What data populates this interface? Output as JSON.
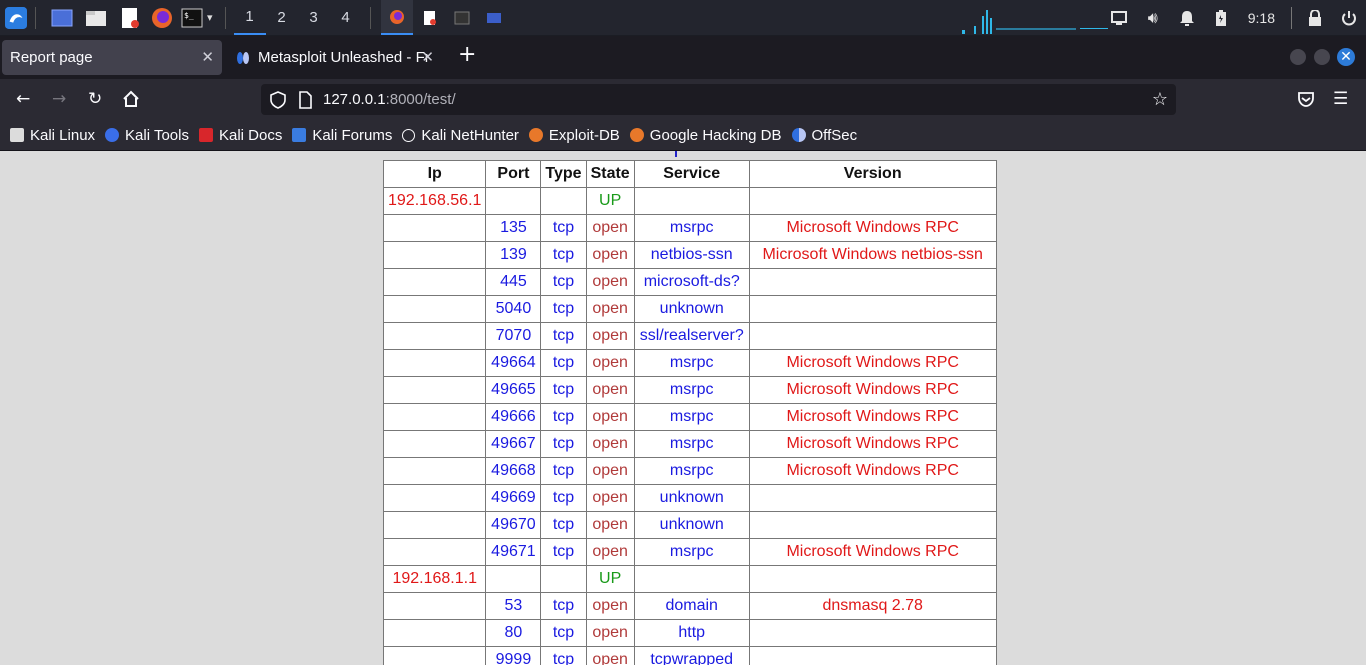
{
  "taskbar": {
    "workspaces": [
      "1",
      "2",
      "3",
      "4"
    ],
    "clock": "9:18"
  },
  "tabs": [
    {
      "label": "Report page",
      "active": true
    },
    {
      "label": "Metasploit Unleashed - Fr",
      "active": false
    }
  ],
  "url": {
    "host": "127.0.0.1",
    "rest": ":8000/test/"
  },
  "bookmarks": [
    {
      "label": "Kali Linux",
      "icon": "kali-dragon-icon"
    },
    {
      "label": "Kali Tools",
      "icon": "kali-tools-icon"
    },
    {
      "label": "Kali Docs",
      "icon": "kali-docs-icon"
    },
    {
      "label": "Kali Forums",
      "icon": "kali-forums-icon"
    },
    {
      "label": "Kali NetHunter",
      "icon": "globe-icon"
    },
    {
      "label": "Exploit-DB",
      "icon": "exploit-db-icon"
    },
    {
      "label": "Google Hacking DB",
      "icon": "ghdb-icon"
    },
    {
      "label": "OffSec",
      "icon": "offsec-icon"
    }
  ],
  "table": {
    "headers": [
      "Ip",
      "Port",
      "Type",
      "State",
      "Service",
      "Version"
    ],
    "rows": [
      {
        "ip": "192.168.56.1",
        "port": "",
        "type": "",
        "state": "UP",
        "service": "",
        "version": ""
      },
      {
        "ip": "",
        "port": "135",
        "type": "tcp",
        "state": "open",
        "service": "msrpc",
        "version": "Microsoft Windows RPC"
      },
      {
        "ip": "",
        "port": "139",
        "type": "tcp",
        "state": "open",
        "service": "netbios-ssn",
        "version": "Microsoft Windows netbios-ssn"
      },
      {
        "ip": "",
        "port": "445",
        "type": "tcp",
        "state": "open",
        "service": "microsoft-ds?",
        "version": ""
      },
      {
        "ip": "",
        "port": "5040",
        "type": "tcp",
        "state": "open",
        "service": "unknown",
        "version": ""
      },
      {
        "ip": "",
        "port": "7070",
        "type": "tcp",
        "state": "open",
        "service": "ssl/realserver?",
        "version": ""
      },
      {
        "ip": "",
        "port": "49664",
        "type": "tcp",
        "state": "open",
        "service": "msrpc",
        "version": "Microsoft Windows RPC"
      },
      {
        "ip": "",
        "port": "49665",
        "type": "tcp",
        "state": "open",
        "service": "msrpc",
        "version": "Microsoft Windows RPC"
      },
      {
        "ip": "",
        "port": "49666",
        "type": "tcp",
        "state": "open",
        "service": "msrpc",
        "version": "Microsoft Windows RPC"
      },
      {
        "ip": "",
        "port": "49667",
        "type": "tcp",
        "state": "open",
        "service": "msrpc",
        "version": "Microsoft Windows RPC"
      },
      {
        "ip": "",
        "port": "49668",
        "type": "tcp",
        "state": "open",
        "service": "msrpc",
        "version": "Microsoft Windows RPC"
      },
      {
        "ip": "",
        "port": "49669",
        "type": "tcp",
        "state": "open",
        "service": "unknown",
        "version": ""
      },
      {
        "ip": "",
        "port": "49670",
        "type": "tcp",
        "state": "open",
        "service": "unknown",
        "version": ""
      },
      {
        "ip": "",
        "port": "49671",
        "type": "tcp",
        "state": "open",
        "service": "msrpc",
        "version": "Microsoft Windows RPC"
      },
      {
        "ip": "192.168.1.1",
        "port": "",
        "type": "",
        "state": "UP",
        "service": "",
        "version": ""
      },
      {
        "ip": "",
        "port": "53",
        "type": "tcp",
        "state": "open",
        "service": "domain",
        "version": "dnsmasq 2.78"
      },
      {
        "ip": "",
        "port": "80",
        "type": "tcp",
        "state": "open",
        "service": "http",
        "version": ""
      },
      {
        "ip": "",
        "port": "9999",
        "type": "tcp",
        "state": "open",
        "service": "tcpwrapped",
        "version": ""
      }
    ]
  }
}
